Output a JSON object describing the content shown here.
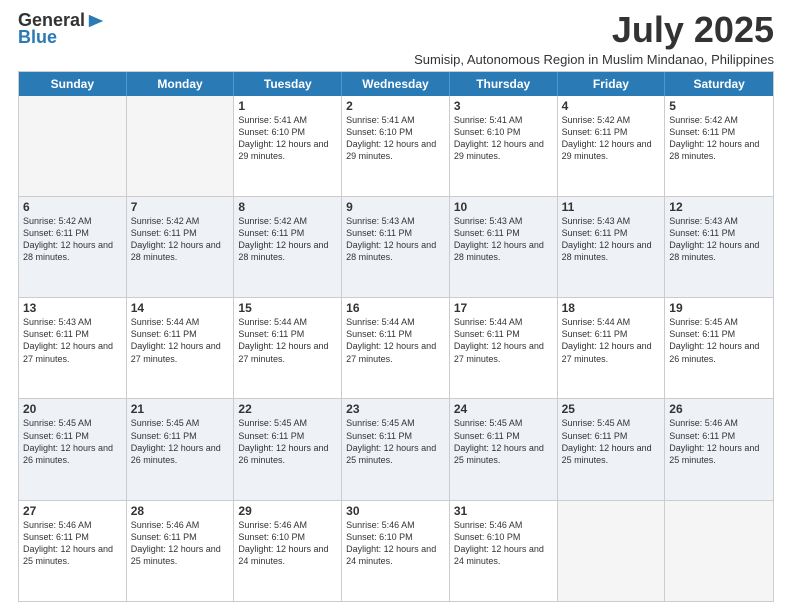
{
  "header": {
    "logo_general": "General",
    "logo_blue": "Blue",
    "title": "July 2025",
    "subtitle": "Sumisip, Autonomous Region in Muslim Mindanao, Philippines"
  },
  "days_of_week": [
    "Sunday",
    "Monday",
    "Tuesday",
    "Wednesday",
    "Thursday",
    "Friday",
    "Saturday"
  ],
  "weeks": [
    [
      {
        "day": "",
        "info": "",
        "empty": true
      },
      {
        "day": "",
        "info": "",
        "empty": true
      },
      {
        "day": "1",
        "info": "Sunrise: 5:41 AM\nSunset: 6:10 PM\nDaylight: 12 hours and 29 minutes."
      },
      {
        "day": "2",
        "info": "Sunrise: 5:41 AM\nSunset: 6:10 PM\nDaylight: 12 hours and 29 minutes."
      },
      {
        "day": "3",
        "info": "Sunrise: 5:41 AM\nSunset: 6:10 PM\nDaylight: 12 hours and 29 minutes."
      },
      {
        "day": "4",
        "info": "Sunrise: 5:42 AM\nSunset: 6:11 PM\nDaylight: 12 hours and 29 minutes."
      },
      {
        "day": "5",
        "info": "Sunrise: 5:42 AM\nSunset: 6:11 PM\nDaylight: 12 hours and 28 minutes."
      }
    ],
    [
      {
        "day": "6",
        "info": "Sunrise: 5:42 AM\nSunset: 6:11 PM\nDaylight: 12 hours and 28 minutes."
      },
      {
        "day": "7",
        "info": "Sunrise: 5:42 AM\nSunset: 6:11 PM\nDaylight: 12 hours and 28 minutes."
      },
      {
        "day": "8",
        "info": "Sunrise: 5:42 AM\nSunset: 6:11 PM\nDaylight: 12 hours and 28 minutes."
      },
      {
        "day": "9",
        "info": "Sunrise: 5:43 AM\nSunset: 6:11 PM\nDaylight: 12 hours and 28 minutes."
      },
      {
        "day": "10",
        "info": "Sunrise: 5:43 AM\nSunset: 6:11 PM\nDaylight: 12 hours and 28 minutes."
      },
      {
        "day": "11",
        "info": "Sunrise: 5:43 AM\nSunset: 6:11 PM\nDaylight: 12 hours and 28 minutes."
      },
      {
        "day": "12",
        "info": "Sunrise: 5:43 AM\nSunset: 6:11 PM\nDaylight: 12 hours and 28 minutes."
      }
    ],
    [
      {
        "day": "13",
        "info": "Sunrise: 5:43 AM\nSunset: 6:11 PM\nDaylight: 12 hours and 27 minutes."
      },
      {
        "day": "14",
        "info": "Sunrise: 5:44 AM\nSunset: 6:11 PM\nDaylight: 12 hours and 27 minutes."
      },
      {
        "day": "15",
        "info": "Sunrise: 5:44 AM\nSunset: 6:11 PM\nDaylight: 12 hours and 27 minutes."
      },
      {
        "day": "16",
        "info": "Sunrise: 5:44 AM\nSunset: 6:11 PM\nDaylight: 12 hours and 27 minutes."
      },
      {
        "day": "17",
        "info": "Sunrise: 5:44 AM\nSunset: 6:11 PM\nDaylight: 12 hours and 27 minutes."
      },
      {
        "day": "18",
        "info": "Sunrise: 5:44 AM\nSunset: 6:11 PM\nDaylight: 12 hours and 27 minutes."
      },
      {
        "day": "19",
        "info": "Sunrise: 5:45 AM\nSunset: 6:11 PM\nDaylight: 12 hours and 26 minutes."
      }
    ],
    [
      {
        "day": "20",
        "info": "Sunrise: 5:45 AM\nSunset: 6:11 PM\nDaylight: 12 hours and 26 minutes."
      },
      {
        "day": "21",
        "info": "Sunrise: 5:45 AM\nSunset: 6:11 PM\nDaylight: 12 hours and 26 minutes."
      },
      {
        "day": "22",
        "info": "Sunrise: 5:45 AM\nSunset: 6:11 PM\nDaylight: 12 hours and 26 minutes."
      },
      {
        "day": "23",
        "info": "Sunrise: 5:45 AM\nSunset: 6:11 PM\nDaylight: 12 hours and 25 minutes."
      },
      {
        "day": "24",
        "info": "Sunrise: 5:45 AM\nSunset: 6:11 PM\nDaylight: 12 hours and 25 minutes."
      },
      {
        "day": "25",
        "info": "Sunrise: 5:45 AM\nSunset: 6:11 PM\nDaylight: 12 hours and 25 minutes."
      },
      {
        "day": "26",
        "info": "Sunrise: 5:46 AM\nSunset: 6:11 PM\nDaylight: 12 hours and 25 minutes."
      }
    ],
    [
      {
        "day": "27",
        "info": "Sunrise: 5:46 AM\nSunset: 6:11 PM\nDaylight: 12 hours and 25 minutes."
      },
      {
        "day": "28",
        "info": "Sunrise: 5:46 AM\nSunset: 6:11 PM\nDaylight: 12 hours and 25 minutes."
      },
      {
        "day": "29",
        "info": "Sunrise: 5:46 AM\nSunset: 6:10 PM\nDaylight: 12 hours and 24 minutes."
      },
      {
        "day": "30",
        "info": "Sunrise: 5:46 AM\nSunset: 6:10 PM\nDaylight: 12 hours and 24 minutes."
      },
      {
        "day": "31",
        "info": "Sunrise: 5:46 AM\nSunset: 6:10 PM\nDaylight: 12 hours and 24 minutes."
      },
      {
        "day": "",
        "info": "",
        "empty": true
      },
      {
        "day": "",
        "info": "",
        "empty": true
      }
    ]
  ],
  "alt_rows": [
    1,
    3
  ],
  "colors": {
    "header_bg": "#2a7ab5",
    "header_text": "#ffffff",
    "alt_row_bg": "#eef2f7",
    "empty_bg": "#f5f5f5",
    "border": "#cccccc"
  }
}
